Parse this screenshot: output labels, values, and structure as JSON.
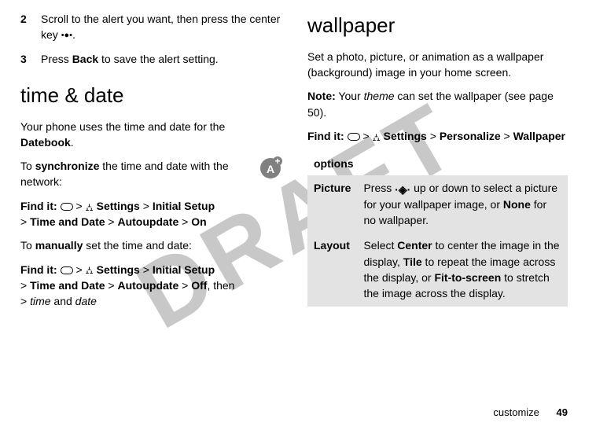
{
  "watermark": "DRAFT",
  "left": {
    "step2_num": "2",
    "step2_text_a": "Scroll to the alert you want, then press the center key ",
    "step2_text_b": ".",
    "step3_num": "3",
    "step3_text_a": "Press ",
    "step3_back": "Back",
    "step3_text_b": " to save the alert setting.",
    "heading": "time & date",
    "intro_a": "Your phone uses the time and date for the ",
    "intro_datebook": "Datebook",
    "intro_b": ".",
    "sync_a": "To ",
    "sync_bold": "synchronize",
    "sync_b": " the time and date with the network:",
    "find1_label": "Find it:",
    "find1_settings": "Settings",
    "find1_initial": "Initial Setup",
    "find1_timedate": "Time and Date",
    "find1_autoupdate": "Autoupdate",
    "find1_on": "On",
    "manual_a": "To ",
    "manual_bold": "manually",
    "manual_b": " set the time and date:",
    "find2_label": "Find it:",
    "find2_settings": "Settings",
    "find2_initial": "Initial Setup",
    "find2_timedate": "Time and Date",
    "find2_autoupdate": "Autoupdate",
    "find2_off": "Off",
    "find2_then": ", then",
    "find2_time": "time",
    "find2_and": " and ",
    "find2_date": "date"
  },
  "right": {
    "heading": "wallpaper",
    "intro": "Set a photo, picture, or animation as a wallpaper (background) image in your home screen.",
    "note_label": "Note:",
    "note_a": " Your ",
    "note_theme": "theme",
    "note_b": " can set the wallpaper (see page 50).",
    "find_label": "Find it:",
    "find_settings": "Settings",
    "find_personalize": "Personalize",
    "find_wallpaper": "Wallpaper",
    "options_header": "options",
    "row1_key": "Picture",
    "row1_a": "Press ",
    "row1_b": " up or down to select a picture for your wallpaper image, or ",
    "row1_none": "None",
    "row1_c": " for no wallpaper.",
    "row2_key": "Layout",
    "row2_a": "Select ",
    "row2_center": "Center",
    "row2_b": " to center the image in the display, ",
    "row2_tile": "Tile",
    "row2_c": " to repeat the image across the display, or ",
    "row2_fit": "Fit-to-screen",
    "row2_d": " to stretch the image across the display."
  },
  "footer": {
    "section": "customize",
    "page": "49"
  },
  "gt": ">"
}
